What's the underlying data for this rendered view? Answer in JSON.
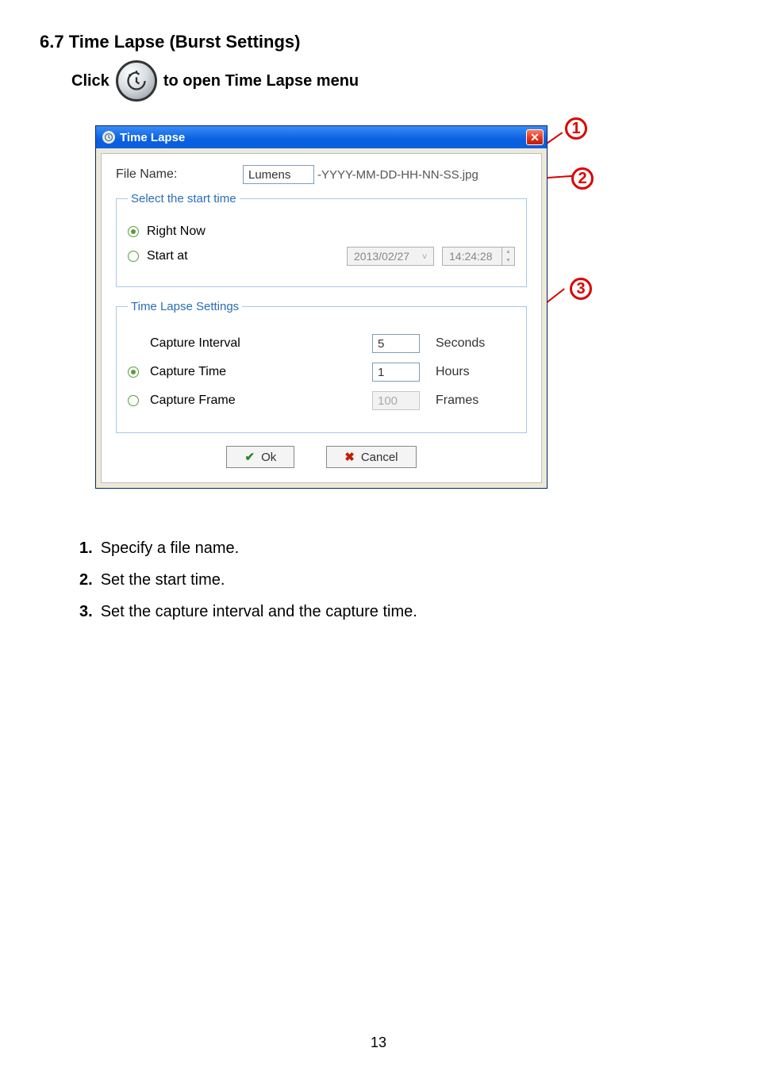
{
  "heading": "6.7  Time Lapse (Burst Settings)",
  "click_line": {
    "pre": "Click",
    "post": "to open Time Lapse menu"
  },
  "dialog": {
    "title": "Time Lapse",
    "file_name_label": "File Name:",
    "file_name_value": "Lumens",
    "file_name_suffix": "-YYYY-MM-DD-HH-NN-SS.jpg",
    "start_group": {
      "legend": "Select the start time",
      "right_now": "Right Now",
      "start_at": "Start at",
      "date": "2013/02/27",
      "time": "14:24:28"
    },
    "tls_group": {
      "legend": "Time Lapse Settings",
      "interval_label": "Capture Interval",
      "interval_value": "5",
      "interval_unit": "Seconds",
      "time_label": "Capture Time",
      "time_value": "1",
      "time_unit": "Hours",
      "frame_label": "Capture Frame",
      "frame_value": "100",
      "frame_unit": "Frames"
    },
    "ok": "Ok",
    "cancel": "Cancel"
  },
  "callouts": {
    "one": "1",
    "two": "2",
    "three": "3"
  },
  "list": {
    "n1": "1.",
    "t1": "Specify a file name.",
    "n2": "2.",
    "t2": "Set the start time.",
    "n3": "3.",
    "t3": "Set the capture interval and the capture time."
  },
  "page": "13"
}
